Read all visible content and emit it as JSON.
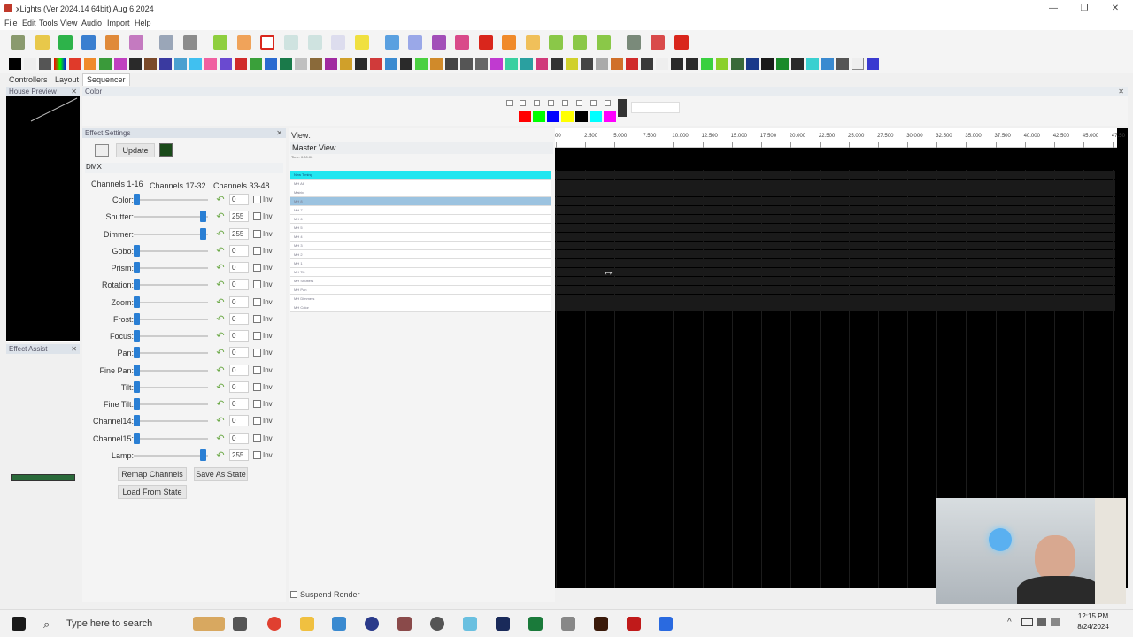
{
  "window": {
    "title": "xLights (Ver 2024.14 64bit) Aug  6 2024",
    "minimize": "—",
    "maximize": "❐",
    "close": "✕"
  },
  "menu": [
    "File",
    "Edit",
    "Tools",
    "View",
    "Audio",
    "Import",
    "Help"
  ],
  "tabs": [
    "Controllers",
    "Layout",
    "Sequencer"
  ],
  "panels": {
    "house_preview": "House Preview",
    "effect_assist": "Effect Assist",
    "color": "Color",
    "effect_settings": "Effect Settings",
    "close": "✕"
  },
  "effect_settings": {
    "update_button": "Update",
    "effect_type": "DMX",
    "channel_tabs": [
      "Channels 1-16",
      "Channels 17-32",
      "Channels 33-48"
    ],
    "channels": [
      {
        "label": "Color:",
        "value": "0",
        "level": 0
      },
      {
        "label": "Shutter:",
        "value": "255",
        "level": 1
      },
      {
        "label": "Dimmer:",
        "value": "255",
        "level": 1
      },
      {
        "label": "Gobo:",
        "value": "0",
        "level": 0
      },
      {
        "label": "Prism:",
        "value": "0",
        "level": 0
      },
      {
        "label": "Rotation:",
        "value": "0",
        "level": 0
      },
      {
        "label": "Zoom:",
        "value": "0",
        "level": 0
      },
      {
        "label": "Frost:",
        "value": "0",
        "level": 0
      },
      {
        "label": "Focus:",
        "value": "0",
        "level": 0
      },
      {
        "label": "Pan:",
        "value": "0",
        "level": 0
      },
      {
        "label": "Fine Pan:",
        "value": "0",
        "level": 0
      },
      {
        "label": "Tilt:",
        "value": "0",
        "level": 0
      },
      {
        "label": "Fine Tilt:",
        "value": "0",
        "level": 0
      },
      {
        "label": "Channel14:",
        "value": "0",
        "level": 0
      },
      {
        "label": "Channel15:",
        "value": "0",
        "level": 0
      },
      {
        "label": "Lamp:",
        "value": "255",
        "level": 1
      }
    ],
    "inv_label": "Inv",
    "remap_button": "Remap Channels",
    "save_state_button": "Save As State",
    "load_state_button": "Load From State"
  },
  "view": {
    "label": "View:",
    "selected": "Master View",
    "time": "Time: 0:00.00",
    "rows": [
      "New Timing",
      "MH All",
      "Matrix",
      "MH 8",
      "MH 7",
      "MH 6",
      "MH 5",
      "MH 4",
      "MH 3",
      "MH 2",
      "MH 1",
      "MH Tilt",
      "MH Shutters",
      "MH Pan",
      "MH Dimmers",
      "MH Color"
    ],
    "suspend_render": "Suspend Render"
  },
  "ruler_ticks": [
    "00",
    "2.500",
    "5.000",
    "7.500",
    "10.000",
    "12.500",
    "15.000",
    "17.500",
    "20.000",
    "22.500",
    "25.000",
    "27.500",
    "30.000",
    "32.500",
    "35.000",
    "37.500",
    "40.000",
    "42.500",
    "45.000",
    "47.50"
  ],
  "colors": {
    "palette": [
      "#ff0000",
      "#00ff00",
      "#0000ff",
      "#ffff00",
      "#000000",
      "#00ffff",
      "#ff00ff"
    ],
    "timing_row": "#22e6f0",
    "slider_thumb": "#2a7fd4"
  },
  "taskbar": {
    "search_placeholder": "Type here to search",
    "time": "12:15 PM",
    "date": "8/24/2024"
  }
}
